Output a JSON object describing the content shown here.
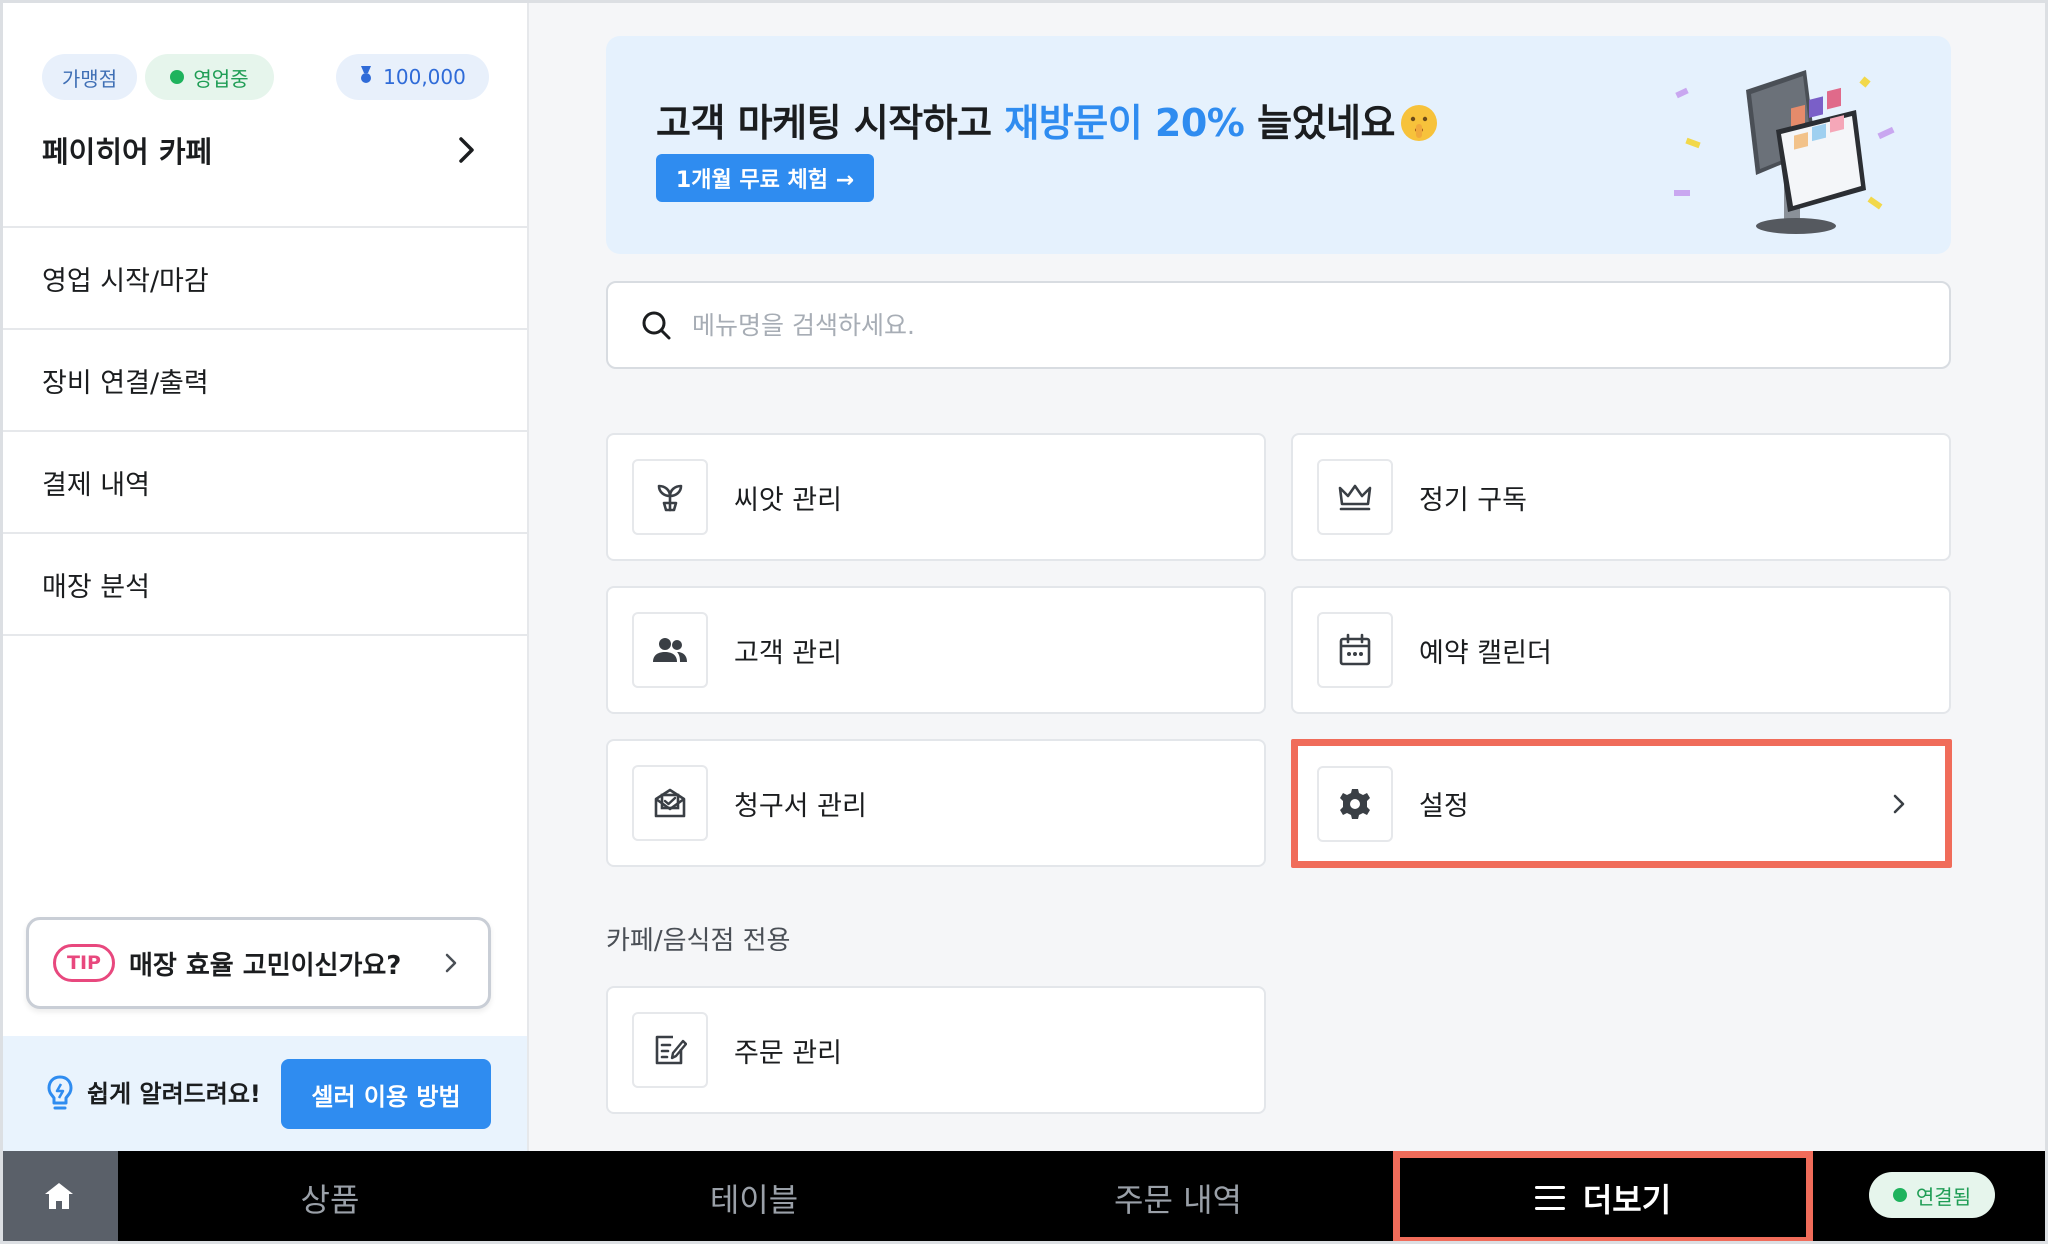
{
  "sidebar": {
    "badges": {
      "franchise": "가맹점",
      "status": "영업중",
      "points": "100,000"
    },
    "store_name": "페이히어 카페",
    "menu": [
      {
        "label": "영업 시작/마감"
      },
      {
        "label": "장비 연결/출력"
      },
      {
        "label": "결제 내역"
      },
      {
        "label": "매장 분석"
      }
    ],
    "tip": {
      "badge": "TIP",
      "text": "매장 효율 고민이신가요?"
    },
    "help": {
      "text": "쉽게 알려드려요!",
      "button": "셀러 이용 방법"
    }
  },
  "banner": {
    "title_prefix": "고객 마케팅 시작하고 ",
    "title_highlight": "재방문이 20%",
    "title_suffix": " 늘었네요",
    "button": "1개월 무료 체험 →"
  },
  "search": {
    "placeholder": "메뉴명을 검색하세요."
  },
  "menu_cards": [
    {
      "label": "씨앗 관리",
      "icon": "sprout-icon"
    },
    {
      "label": "정기 구독",
      "icon": "crown-icon"
    },
    {
      "label": "고객 관리",
      "icon": "people-icon"
    },
    {
      "label": "예약 캘린더",
      "icon": "calendar-icon"
    },
    {
      "label": "청구서 관리",
      "icon": "invoice-icon"
    },
    {
      "label": "설정",
      "icon": "gear-icon"
    }
  ],
  "section": {
    "title": "카페/음식점 전용",
    "cards": [
      {
        "label": "주문 관리",
        "icon": "order-edit-icon"
      }
    ]
  },
  "bottom_nav": {
    "tabs": [
      {
        "label": "상품"
      },
      {
        "label": "테이블"
      },
      {
        "label": "주문 내역"
      },
      {
        "label": "더보기"
      }
    ],
    "connection": "연결됨"
  },
  "colors": {
    "accent": "#2f8cf0",
    "highlight_border": "#f06c5a",
    "status_green": "#1fb35d",
    "tip_pink": "#e8487e"
  }
}
